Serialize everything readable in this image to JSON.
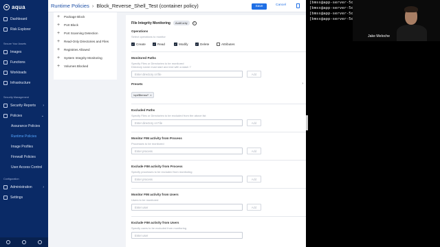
{
  "brand": {
    "name": "aqua"
  },
  "sidebar": {
    "top_items": [
      {
        "label": "Dashboard",
        "icon": "dashboard-icon"
      },
      {
        "label": "Risk Explorer",
        "icon": "risk-explorer-icon"
      }
    ],
    "secure_section_title": "Secure Your Assets",
    "secure_items": [
      {
        "label": "Images",
        "icon": "images-icon"
      },
      {
        "label": "Functions",
        "icon": "functions-icon"
      },
      {
        "label": "Workloads",
        "icon": "workloads-icon"
      },
      {
        "label": "Infrastructure",
        "icon": "infrastructure-icon"
      }
    ],
    "security_section_title": "Security Management",
    "security_items": [
      {
        "label": "Security Reports",
        "icon": "security-reports-icon"
      },
      {
        "label": "Policies",
        "icon": "policies-icon"
      }
    ],
    "policies_sub": [
      {
        "label": "Assurance Policies"
      },
      {
        "label": "Runtime Policies"
      },
      {
        "label": "Image Profiles"
      },
      {
        "label": "Firewall Policies"
      },
      {
        "label": "User Access Control"
      }
    ],
    "config_section_title": "Configuration",
    "config_items": [
      {
        "label": "Administration",
        "icon": "administration-icon"
      },
      {
        "label": "Settings",
        "icon": "settings-icon"
      }
    ]
  },
  "header": {
    "crumb_parent": "Runtime Policies",
    "crumb_sep": "›",
    "crumb_current": "Block_Reverse_Shell_Test (container policy)",
    "save_label": "Save",
    "cancel_label": "Cancel"
  },
  "controls_list": [
    "Package Block",
    "Port Block",
    "Port Scanning Detection",
    "Read-Only Directories and Files",
    "Registries Allowed",
    "System Integrity Monitoring",
    "Volumes Blocked"
  ],
  "panel": {
    "title": "File Integrity Monitoring",
    "badge": "Audit only",
    "operations": {
      "title": "Operations",
      "help": "Select operations to monitor",
      "options": [
        {
          "label": "Create",
          "checked": true
        },
        {
          "label": "Read",
          "checked": true
        },
        {
          "label": "Modify",
          "checked": true
        },
        {
          "label": "Delete",
          "checked": true
        },
        {
          "label": "Attributes",
          "checked": false
        }
      ]
    },
    "monitored_paths": {
      "title": "Monitored Paths",
      "help1": "Specify Files or Directories to be monitored",
      "help2": "Directory name must start and end with a slash '/'",
      "placeholder": "Enter directory or file",
      "add_label": "Add"
    },
    "presets": {
      "title": "Presets",
      "chip": "/opt/$bmss/*"
    },
    "excluded_paths": {
      "title": "Excluded Paths",
      "help": "Specify Files or Directories to be excluded from the above list",
      "placeholder": "Enter directory or File",
      "add_label": "Add"
    },
    "monitor_process": {
      "title": "Monitor FIM activity from Process",
      "help": "Processes to be monitored",
      "placeholder": "Enter process",
      "add_label": "Add"
    },
    "exclude_process": {
      "title": "Exclude FIM activity from Process",
      "help": "Specify processes to be excluded from monitoring",
      "placeholder": "Enter process",
      "add_label": "Add"
    },
    "monitor_users": {
      "title": "Monitor FIM activity from Users",
      "help": "Users to be monitored",
      "placeholder": "Enter user",
      "add_label": "Add"
    },
    "exclude_users": {
      "title": "Exclude FIM activity from Users",
      "help": "Specify users to be excluded from monitoring",
      "placeholder": "Enter user"
    }
  },
  "terminal": {
    "lines": [
      "[bmss@app-server-5df756",
      "[bmss@app-server-5df756",
      "[bmss@app-server-5df756",
      "[bmss@app-server-5df756"
    ]
  },
  "webcam": {
    "name": "Jake Meloche"
  },
  "colors": {
    "sidebar": "#0a2a66",
    "accent": "#1f6fe5",
    "active_sub": "#55a6ff"
  }
}
